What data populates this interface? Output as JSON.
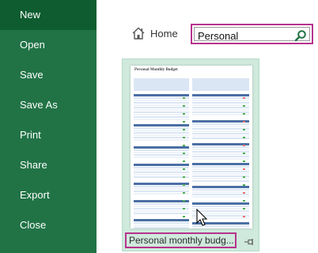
{
  "sidebar": {
    "items": [
      {
        "label": "New",
        "active": true
      },
      {
        "label": "Open"
      },
      {
        "label": "Save"
      },
      {
        "label": "Save As"
      },
      {
        "label": "Print"
      },
      {
        "label": "Share"
      },
      {
        "label": "Export"
      },
      {
        "label": "Close"
      }
    ]
  },
  "header": {
    "home_label": "Home",
    "home_icon": "home-icon"
  },
  "search": {
    "value": "Personal",
    "icon": "search-icon"
  },
  "template": {
    "thumbnail_title": "Personal Monthly Budget",
    "caption": "Personal monthly budg...",
    "pin_icon": "pin-icon"
  },
  "colors": {
    "sidebar_bg": "#217346",
    "sidebar_active": "#0e5c30",
    "highlight_border": "#b6338d",
    "tile_bg": "#cfe9dc"
  }
}
